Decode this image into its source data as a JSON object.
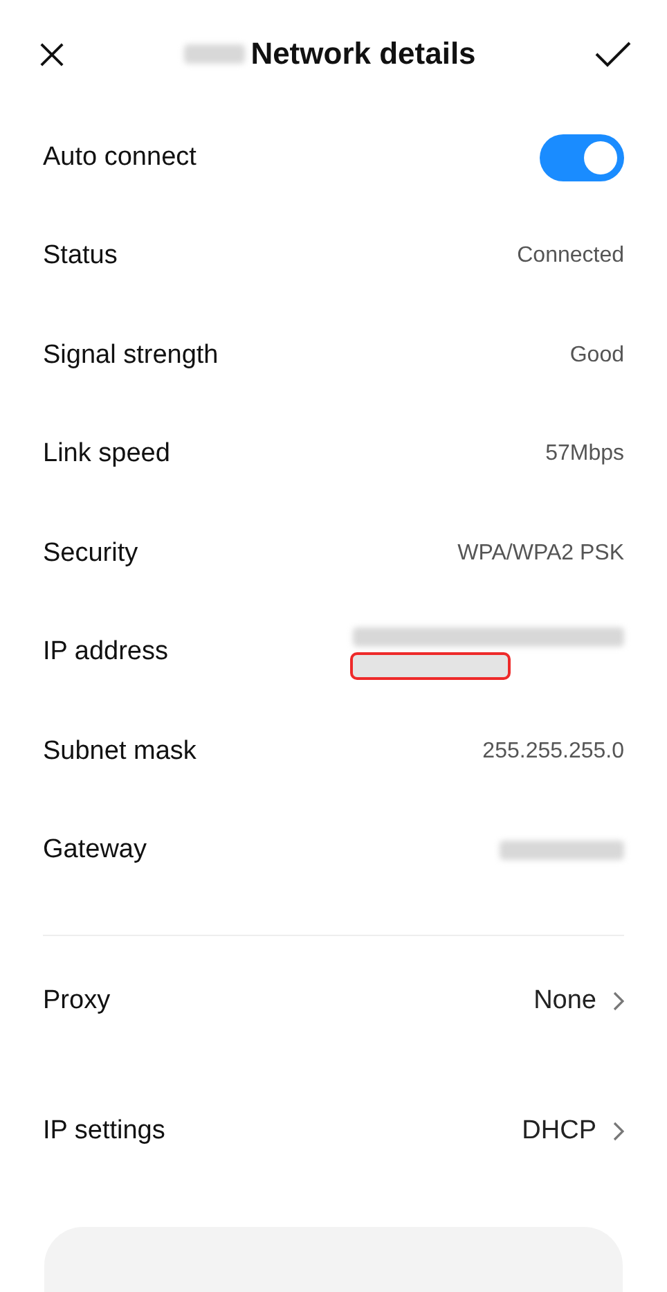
{
  "header": {
    "title": "Network details",
    "redacted_prefix": true
  },
  "toggle": {
    "label": "Auto connect",
    "on": true
  },
  "details": [
    {
      "label": "Status",
      "kind": "value",
      "value": "Connected"
    },
    {
      "label": "Signal strength",
      "kind": "value",
      "value": "Good"
    },
    {
      "label": "Link speed",
      "kind": "value",
      "value": "57Mbps"
    },
    {
      "label": "Security",
      "kind": "value",
      "value": "WPA/WPA2 PSK"
    },
    {
      "label": "IP address",
      "kind": "redacted",
      "redacted": [
        {
          "highlighted": false
        },
        {
          "highlighted": true
        }
      ]
    },
    {
      "label": "Subnet mask",
      "kind": "value",
      "value": "255.255.255.0"
    },
    {
      "label": "Gateway",
      "kind": "redacted",
      "redacted": [
        {
          "highlighted": false
        }
      ]
    }
  ],
  "settings": [
    {
      "label": "Proxy",
      "value": "None"
    },
    {
      "label": "IP settings",
      "value": "DHCP"
    }
  ]
}
